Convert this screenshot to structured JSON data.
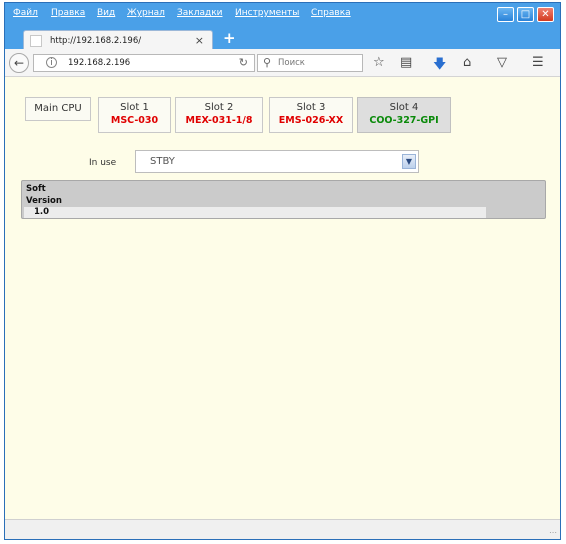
{
  "menu": {
    "items": [
      "Файл",
      "Правка",
      "Вид",
      "Журнал",
      "Закладки",
      "Инструменты",
      "Справка"
    ]
  },
  "window_controls": {
    "minimize": "–",
    "maximize": "□",
    "close": "✕"
  },
  "tab": {
    "title": "http://192.168.2.196/",
    "close": "×",
    "new_tab": "+"
  },
  "navbar": {
    "url": "192.168.2.196",
    "search_placeholder": "Поиск",
    "icons": [
      "back-icon",
      "info-icon",
      "reload-icon",
      "search-icon",
      "star-icon",
      "reader-icon",
      "download-icon",
      "home-icon",
      "pocket-icon",
      "menu-icon"
    ]
  },
  "slots": [
    {
      "name": "Main CPU",
      "module": ""
    },
    {
      "name": "Slot 1",
      "module": "MSC-030",
      "module_color": "#e00000"
    },
    {
      "name": "Slot 2",
      "module": "MEX-031-1/8",
      "module_color": "#e00000"
    },
    {
      "name": "Slot 3",
      "module": "EMS-026-XX",
      "module_color": "#e00000"
    },
    {
      "name": "Slot 4",
      "module": "COO-327-GPI",
      "module_color": "#0a8a0a",
      "active": true
    }
  ],
  "in_use": {
    "label": "In use",
    "value": "STBY"
  },
  "soft_version": {
    "label_line1": "Soft",
    "label_line2": "Version",
    "value": "1.0"
  },
  "colors": {
    "window_frame": "#4aa0e8",
    "content_bg": "#fefde8",
    "panel_bg": "#cbcbcb"
  }
}
